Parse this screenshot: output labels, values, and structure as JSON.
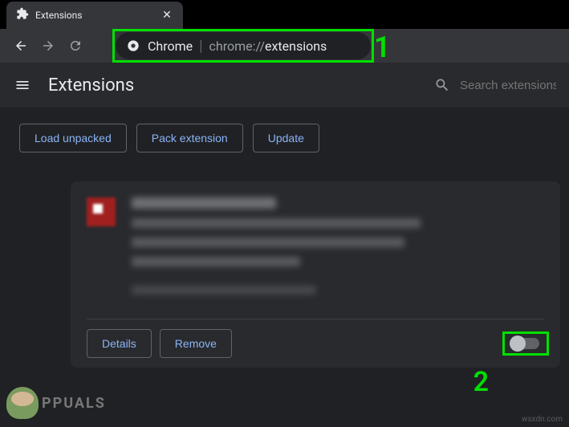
{
  "tab": {
    "title": "Extensions"
  },
  "omnibox": {
    "label": "Chrome",
    "url_scheme": "chrome://",
    "url_path": "extensions"
  },
  "annotations": {
    "one": "1",
    "two": "2"
  },
  "ext_page": {
    "title": "Extensions",
    "search_placeholder": "Search extensions"
  },
  "action_bar": {
    "load_unpacked": "Load unpacked",
    "pack_extension": "Pack extension",
    "update": "Update"
  },
  "card": {
    "details": "Details",
    "remove": "Remove",
    "toggle_state": "off"
  },
  "watermark": "wsxdn.com",
  "logo_text": "PPUALS"
}
